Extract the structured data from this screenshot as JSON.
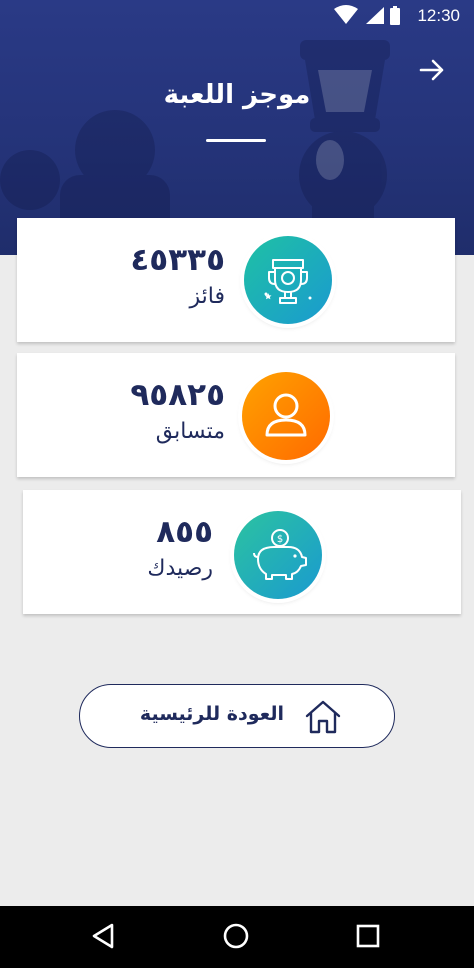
{
  "status_bar": {
    "time": "12:30"
  },
  "header": {
    "title": "موجز اللعبة"
  },
  "cards": [
    {
      "value": "٤٥٣٣٥",
      "label": "فائز",
      "icon": "trophy-icon",
      "color_start": "#22b8a8",
      "color_end": "#1a9ad0"
    },
    {
      "value": "٩٥٨٢٥",
      "label": "متسابق",
      "icon": "user-icon",
      "color_start": "#ff9a00",
      "color_end": "#ff6a00"
    },
    {
      "value": "٨٥٥",
      "label": "رصيدك",
      "icon": "piggy-bank-icon",
      "color_start": "#27b5a3",
      "color_end": "#1a9ad0"
    }
  ],
  "home_button": {
    "label": "العودة للرئيسية",
    "icon": "home-icon"
  },
  "colors": {
    "header": "#243378",
    "text_dark": "#1f2a5c",
    "background": "#ececec"
  },
  "nav_bar": {
    "back_icon": "triangle-back-icon",
    "home_icon": "circle-home-icon",
    "recent_icon": "square-recents-icon"
  }
}
